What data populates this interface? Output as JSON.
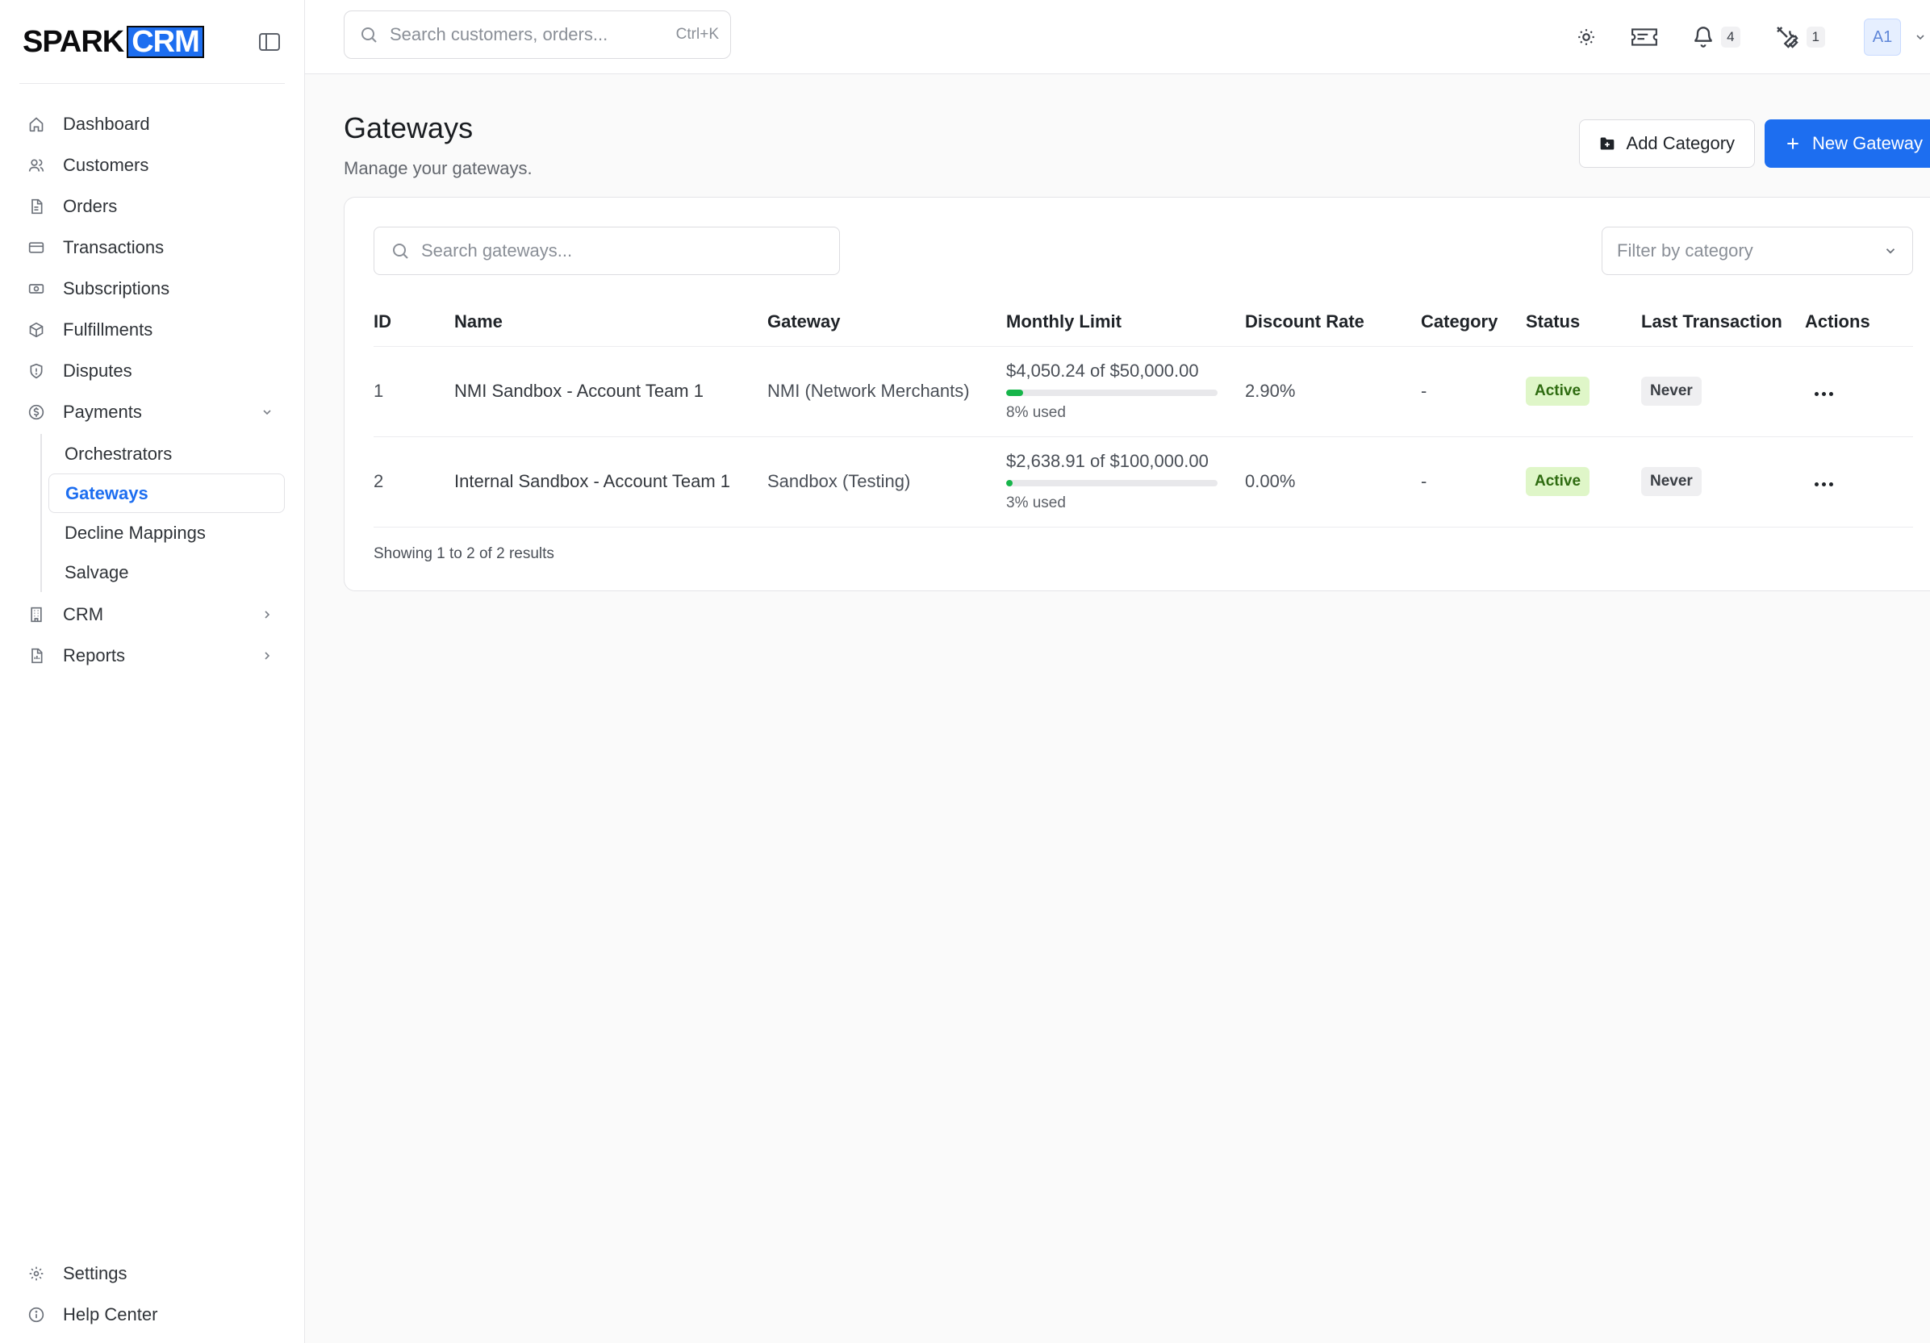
{
  "brand": {
    "part1": "SPARK",
    "part2": "CRM"
  },
  "sidebar": {
    "items": [
      {
        "label": "Dashboard",
        "icon": "home-icon"
      },
      {
        "label": "Customers",
        "icon": "users-icon"
      },
      {
        "label": "Orders",
        "icon": "file-icon"
      },
      {
        "label": "Transactions",
        "icon": "credit-card-icon"
      },
      {
        "label": "Subscriptions",
        "icon": "cash-icon"
      },
      {
        "label": "Fulfillments",
        "icon": "box-icon"
      },
      {
        "label": "Disputes",
        "icon": "shield-icon"
      },
      {
        "label": "Payments",
        "icon": "dollar-circle-icon"
      }
    ],
    "payments_sub": [
      "Orchestrators",
      "Gateways",
      "Decline Mappings",
      "Salvage"
    ],
    "more": [
      {
        "label": "CRM",
        "icon": "building-icon"
      },
      {
        "label": "Reports",
        "icon": "report-icon"
      }
    ],
    "bottom": [
      {
        "label": "Settings",
        "icon": "gear-icon"
      },
      {
        "label": "Help Center",
        "icon": "info-icon"
      }
    ]
  },
  "topbar": {
    "search_placeholder": "Search customers, orders...",
    "shortcut": "Ctrl+K",
    "notifications_count": "4",
    "tools_count": "1",
    "avatar": "A1"
  },
  "page": {
    "title": "Gateways",
    "subtitle": "Manage your gateways.",
    "add_category": "Add Category",
    "new_gateway": "New Gateway"
  },
  "table": {
    "search_placeholder": "Search gateways...",
    "filter_placeholder": "Filter by category",
    "columns": [
      "ID",
      "Name",
      "Gateway",
      "Monthly Limit",
      "Discount Rate",
      "Category",
      "Status",
      "Last Transaction",
      "Actions"
    ],
    "rows": [
      {
        "id": "1",
        "name": "NMI Sandbox - Account Team 1",
        "gateway": "NMI (Network Merchants)",
        "used_amount": "$4,050.24",
        "of": "of",
        "limit": "$50,000.00",
        "used_fraction": 0.08,
        "used_label": "8% used",
        "discount": "2.90%",
        "category": "-",
        "status": "Active",
        "last_txn": "Never"
      },
      {
        "id": "2",
        "name": "Internal Sandbox - Account Team 1",
        "gateway": "Sandbox (Testing)",
        "used_amount": "$2,638.91",
        "of": "of",
        "limit": "$100,000.00",
        "used_fraction": 0.03,
        "used_label": "3% used",
        "discount": "0.00%",
        "category": "-",
        "status": "Active",
        "last_txn": "Never"
      }
    ],
    "footer": "Showing 1 to 2 of 2 results"
  },
  "colors": {
    "accent": "#1d6ef0",
    "progress": "#16b54a",
    "active_bg": "#dff6c8"
  }
}
